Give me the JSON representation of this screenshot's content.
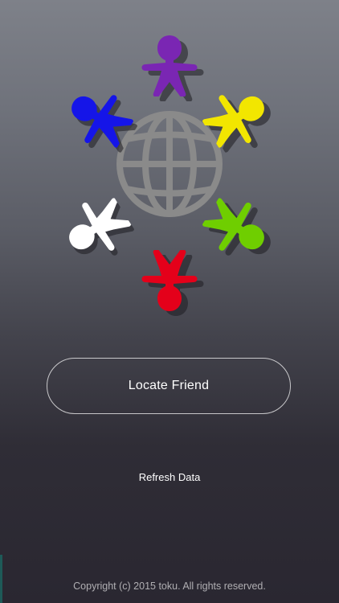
{
  "app": {
    "logo_icon": "globe-with-people-icon",
    "figure_colors": [
      "#7a26b3",
      "#f2e600",
      "#6fce00",
      "#e4001a",
      "#ffffff",
      "#1515e8"
    ],
    "globe_color": "#8a8a8a"
  },
  "actions": {
    "locate_label": "Locate Friend",
    "refresh_label": "Refresh Data"
  },
  "footer": {
    "copyright": "Copyright (c) 2015 toku. All rights reserved."
  }
}
